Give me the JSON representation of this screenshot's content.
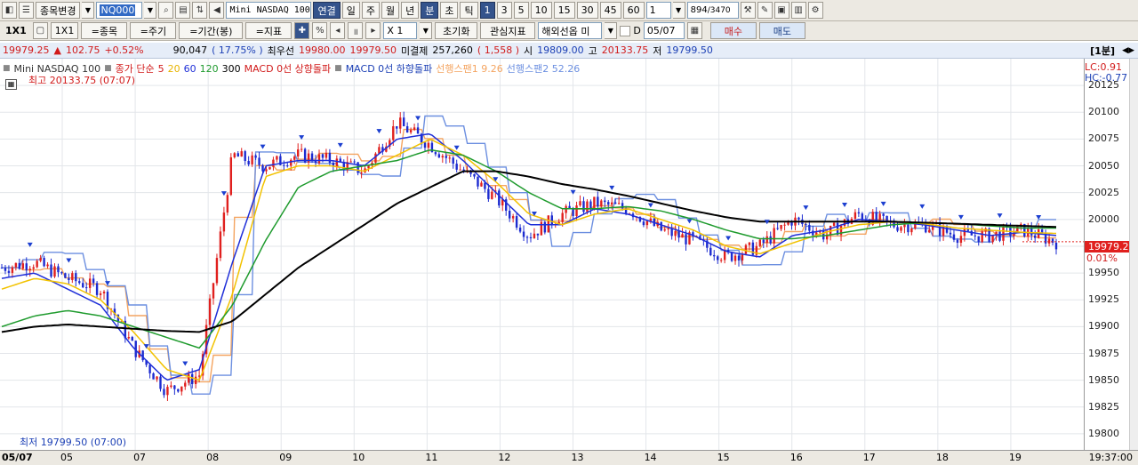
{
  "toolbar1": {
    "symbol_change_label": "종목변경",
    "symbol_code": "NQ000",
    "symbol_name": "Mini NASDAQ 100",
    "link_label": "연결",
    "periods": [
      "일",
      "주",
      "월",
      "년",
      "분",
      "초",
      "틱"
    ],
    "selected_period": "분",
    "intervals": [
      "1",
      "3",
      "5",
      "10",
      "15",
      "30",
      "45",
      "60"
    ],
    "interval_value": "1",
    "count_value": "894",
    "count_total": "/3470"
  },
  "toolbar2": {
    "layout_label": "1X1",
    "layout_label2": "1X1",
    "symbol_btn": "=종목",
    "cycle_btn": "=주기",
    "period_btn": "=기간(봉)",
    "indicator_btn": "=지표",
    "zoom_value": "X 1",
    "reset_btn": "초기화",
    "interest_btn": "관심지표",
    "overseas_btn": "해외선옵 미",
    "date_prefix": "D",
    "date_value": "05/07",
    "buy_btn": "매수",
    "sell_btn": "매도"
  },
  "quote": {
    "price": "19979.25",
    "change_arrow": "▲",
    "change": "102.75",
    "change_pct": "+0.52%",
    "volume": "90,047",
    "volume_pct": "( 17.75% )",
    "best_label": "최우선",
    "best_ask": "19980.00",
    "best_bid": "19979.50",
    "oi_label": "미결제",
    "open_interest": "257,260",
    "oi_change": "( 1,558 )",
    "open_label": "시",
    "open": "19809.00",
    "high_label": "고",
    "high": "20133.75",
    "low_label": "저",
    "low": "19799.50",
    "period_tag": "[1분]"
  },
  "legend": {
    "symbol": "Mini NASDAQ 100",
    "ma_label": "종가 단순",
    "ma_periods": [
      "5",
      "20",
      "60",
      "120",
      "300"
    ],
    "macd_up": "MACD 0선 상향돌파",
    "macd_down": "MACD 0선 하향돌파",
    "span1": "선행스팬1 9.26",
    "span2": "선행스팬2 52.26"
  },
  "annotations": {
    "high": "최고 20133.75 (07:07)",
    "low": "최저 19799.50 (07:00)",
    "lc": "LC:0.91",
    "hc": "HC:-0.77",
    "current_price": "19979.25",
    "current_pct": "0.01%"
  },
  "time_axis": {
    "start_label": "05/07",
    "clock": "19:37:00",
    "labels": [
      "05",
      "07",
      "08",
      "09",
      "10",
      "11",
      "12",
      "13",
      "14",
      "15",
      "16",
      "17",
      "18",
      "19"
    ]
  },
  "colors": {
    "candle_up": "#e0201e",
    "candle_down": "#1c2bd0",
    "ma5": "#1f2fd8",
    "ma20": "#f2c200",
    "ma60": "#1f9b2e",
    "ma120": "#000000",
    "span1": "#f4a460",
    "span2": "#6c8fe0"
  },
  "chart_data": {
    "type": "line",
    "title": "",
    "ylim": [
      19785,
      20150
    ],
    "y_ticks": [
      20125,
      20100,
      20075,
      20050,
      20025,
      20000,
      19975,
      19950,
      19925,
      19900,
      19875,
      19850,
      19825,
      19800
    ],
    "x_categories": [
      "05/07",
      "05",
      "07",
      "08",
      "09",
      "10",
      "11",
      "12",
      "13",
      "14",
      "15",
      "16",
      "17",
      "18",
      "19"
    ],
    "series": [
      {
        "name": "종가",
        "values": [
          19955,
          19960,
          19945,
          19935,
          19880,
          19840,
          19855,
          20060,
          20050,
          20060,
          20055,
          20045,
          20090,
          20070,
          20045,
          20020,
          19985,
          20005,
          20015,
          20010,
          19990,
          19980,
          19965,
          19975,
          20000,
          19985,
          20005,
          19995,
          19995,
          19985,
          19985,
          19990,
          19979
        ]
      },
      {
        "name": "5",
        "values": [
          19945,
          19950,
          19935,
          19920,
          19880,
          19850,
          19860,
          19960,
          20050,
          20055,
          20055,
          20050,
          20075,
          20080,
          20055,
          20025,
          19995,
          19995,
          20010,
          20005,
          19995,
          19985,
          19970,
          19965,
          19985,
          19990,
          20000,
          19998,
          19995,
          19990,
          19985,
          19988,
          19985
        ]
      },
      {
        "name": "20",
        "values": [
          19935,
          19945,
          19940,
          19925,
          19895,
          19860,
          19850,
          19930,
          20040,
          20050,
          20050,
          20045,
          20060,
          20075,
          20060,
          20035,
          20005,
          19995,
          20005,
          20010,
          20000,
          19990,
          19975,
          19968,
          19978,
          19988,
          19995,
          19998,
          19996,
          19992,
          19990,
          19988,
          19987
        ]
      },
      {
        "name": "60",
        "values": [
          19900,
          19910,
          19915,
          19910,
          19900,
          19890,
          19880,
          19920,
          19980,
          20030,
          20045,
          20050,
          20055,
          20065,
          20060,
          20045,
          20025,
          20010,
          20010,
          20012,
          20008,
          20000,
          19990,
          19982,
          19982,
          19985,
          19990,
          19995,
          19997,
          19996,
          19994,
          19992,
          19992
        ]
      },
      {
        "name": "120",
        "values": [
          19895,
          19900,
          19902,
          19900,
          19898,
          19896,
          19895,
          19905,
          19930,
          19955,
          19975,
          19995,
          20015,
          20030,
          20045,
          20045,
          20040,
          20033,
          20028,
          20022,
          20015,
          20008,
          20002,
          19998,
          19998,
          19998,
          19998,
          19998,
          19997,
          19996,
          19995,
          19994,
          19993
        ]
      }
    ]
  }
}
